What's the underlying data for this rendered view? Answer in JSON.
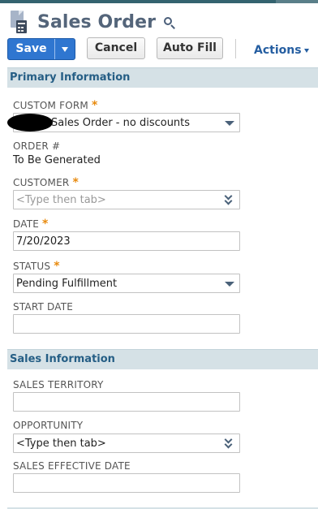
{
  "header": {
    "title": "Sales Order",
    "record_icon": "sales-order-calculator-icon",
    "search_icon": "search-icon"
  },
  "toolbar": {
    "save_label": "Save",
    "cancel_label": "Cancel",
    "autofill_label": "Auto Fill",
    "actions_label": "Actions"
  },
  "sections": {
    "primary": "Primary Information",
    "sales": "Sales Information"
  },
  "primary": {
    "custom_form": {
      "label": "CUSTOM FORM",
      "required": "*",
      "value": "Sales Order - no discounts"
    },
    "order_no": {
      "label": "ORDER #",
      "value": "To Be Generated"
    },
    "customer": {
      "label": "CUSTOMER",
      "required": "*",
      "placeholder": "<Type then tab>"
    },
    "date": {
      "label": "DATE",
      "required": "*",
      "value": "7/20/2023"
    },
    "status": {
      "label": "STATUS",
      "required": "*",
      "value": "Pending Fulfillment"
    },
    "start_date": {
      "label": "START DATE",
      "value": ""
    }
  },
  "sales": {
    "territory": {
      "label": "SALES TERRITORY",
      "value": ""
    },
    "opportunity": {
      "label": "OPPORTUNITY",
      "value": "<Type then tab>"
    },
    "effective_date": {
      "label": "SALES EFFECTIVE DATE",
      "value": ""
    }
  },
  "colors": {
    "accent_blue": "#2f76d0",
    "section_bg": "#d5e1e6",
    "section_text": "#255e85",
    "required_marker": "#e88a0e",
    "top_bar": "#34636f"
  }
}
